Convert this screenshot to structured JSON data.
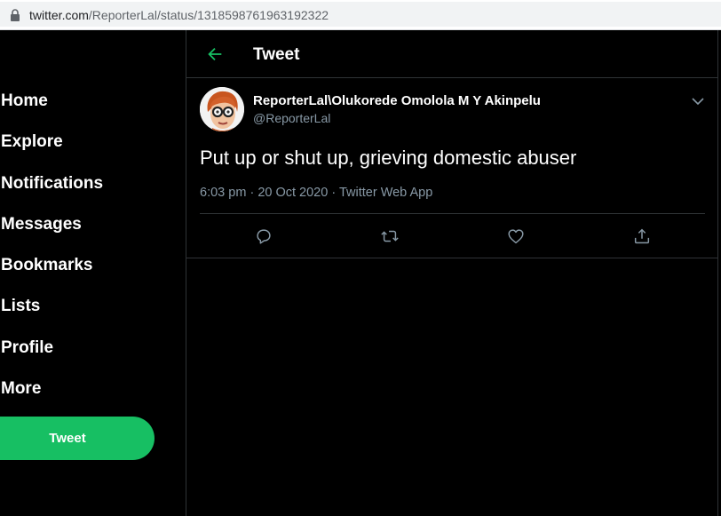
{
  "browser": {
    "url_host": "twitter.com",
    "url_path": "/ReporterLal/status/1318598761963192322"
  },
  "sidebar": {
    "items": [
      {
        "label": "Home"
      },
      {
        "label": "Explore"
      },
      {
        "label": "Notifications"
      },
      {
        "label": "Messages"
      },
      {
        "label": "Bookmarks"
      },
      {
        "label": "Lists"
      },
      {
        "label": "Profile"
      },
      {
        "label": "More"
      }
    ],
    "tweet_button": "Tweet"
  },
  "header": {
    "title": "Tweet",
    "back_icon": "arrow-left-icon"
  },
  "tweet": {
    "display_name": "ReporterLal\\Olukorede Omolola M Y Akinpelu",
    "handle": "@ReporterLal",
    "text": "Put up or shut up, grieving domestic abuser",
    "time": "6:03 pm",
    "date": "20 Oct 2020",
    "source": "Twitter Web App",
    "separator": "·"
  },
  "colors": {
    "accent": "#17bf63",
    "background": "#000000",
    "secondary_text": "#8899a6",
    "border": "#2f3336"
  },
  "icons": {
    "reply": "reply-icon",
    "retweet": "retweet-icon",
    "like": "heart-icon",
    "share": "share-icon",
    "more": "chevron-down-icon"
  }
}
